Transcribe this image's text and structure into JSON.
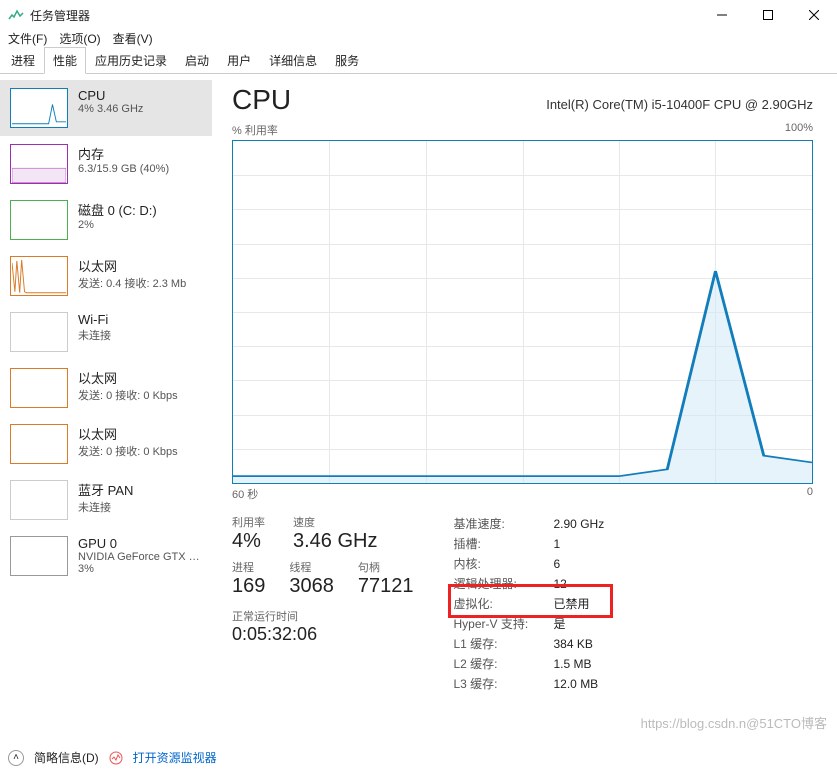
{
  "window": {
    "title": "任务管理器"
  },
  "menu": {
    "file": "文件(F)",
    "options": "选项(O)",
    "view": "查看(V)"
  },
  "tabs": [
    "进程",
    "性能",
    "应用历史记录",
    "启动",
    "用户",
    "详细信息",
    "服务"
  ],
  "active_tab": 1,
  "sidebar": {
    "items": [
      {
        "name": "CPU",
        "sub": "4% 3.46 GHz",
        "color": "#117dbb"
      },
      {
        "name": "内存",
        "sub": "6.3/15.9 GB (40%)",
        "color": "#9b2fae"
      },
      {
        "name": "磁盘 0 (C: D:)",
        "sub": "2%",
        "color": "#4caf50"
      },
      {
        "name": "以太网",
        "sub": "发送: 0.4 接收: 2.3 Mb",
        "color": "#d97b29"
      },
      {
        "name": "Wi-Fi",
        "sub": "未连接",
        "color": "#bbb"
      },
      {
        "name": "以太网",
        "sub": "发送: 0 接收: 0 Kbps",
        "color": "#d97b29"
      },
      {
        "name": "以太网",
        "sub": "发送: 0 接收: 0 Kbps",
        "color": "#d97b29"
      },
      {
        "name": "蓝牙 PAN",
        "sub": "未连接",
        "color": "#bbb"
      },
      {
        "name": "GPU 0",
        "sub": "NVIDIA GeForce GTX …",
        "sub2": "3%"
      }
    ]
  },
  "header": {
    "title": "CPU",
    "model": "Intel(R) Core(TM) i5-10400F CPU @ 2.90GHz"
  },
  "chart": {
    "topleft": "% 利用率",
    "topright": "100%",
    "xleft": "60 秒",
    "xright": "0"
  },
  "stats": {
    "util_label": "利用率",
    "util_val": "4%",
    "speed_label": "速度",
    "speed_val": "3.46 GHz",
    "proc_label": "进程",
    "proc_val": "169",
    "thr_label": "线程",
    "thr_val": "3068",
    "hnd_label": "句柄",
    "hnd_val": "77121",
    "uptime_label": "正常运行时间",
    "uptime_val": "0:05:32:06"
  },
  "details": {
    "basefreq_k": "基准速度:",
    "basefreq_v": "2.90 GHz",
    "sockets_k": "插槽:",
    "sockets_v": "1",
    "cores_k": "内核:",
    "cores_v": "6",
    "lproc_k": "逻辑处理器:",
    "lproc_v": "12",
    "virt_k": "虚拟化:",
    "virt_v": "已禁用",
    "hyperv_k": "Hyper-V 支持:",
    "hyperv_v": "是",
    "l1_k": "L1 缓存:",
    "l1_v": "384 KB",
    "l2_k": "L2 缓存:",
    "l2_v": "1.5 MB",
    "l3_k": "L3 缓存:",
    "l3_v": "12.0 MB"
  },
  "footer": {
    "fewer": "简略信息(D)",
    "resmon": "打开资源监视器"
  },
  "watermark": "https://blog.csdn.n@51CTO博客",
  "chart_data": {
    "type": "line",
    "title": "% 利用率",
    "ylabel": "",
    "ylim": [
      0,
      100
    ],
    "x_seconds": [
      60,
      55,
      50,
      45,
      40,
      35,
      30,
      25,
      20,
      15,
      10,
      5,
      0
    ],
    "values": [
      2,
      2,
      2,
      2,
      2,
      2,
      2,
      2,
      2,
      4,
      62,
      8,
      6
    ]
  }
}
